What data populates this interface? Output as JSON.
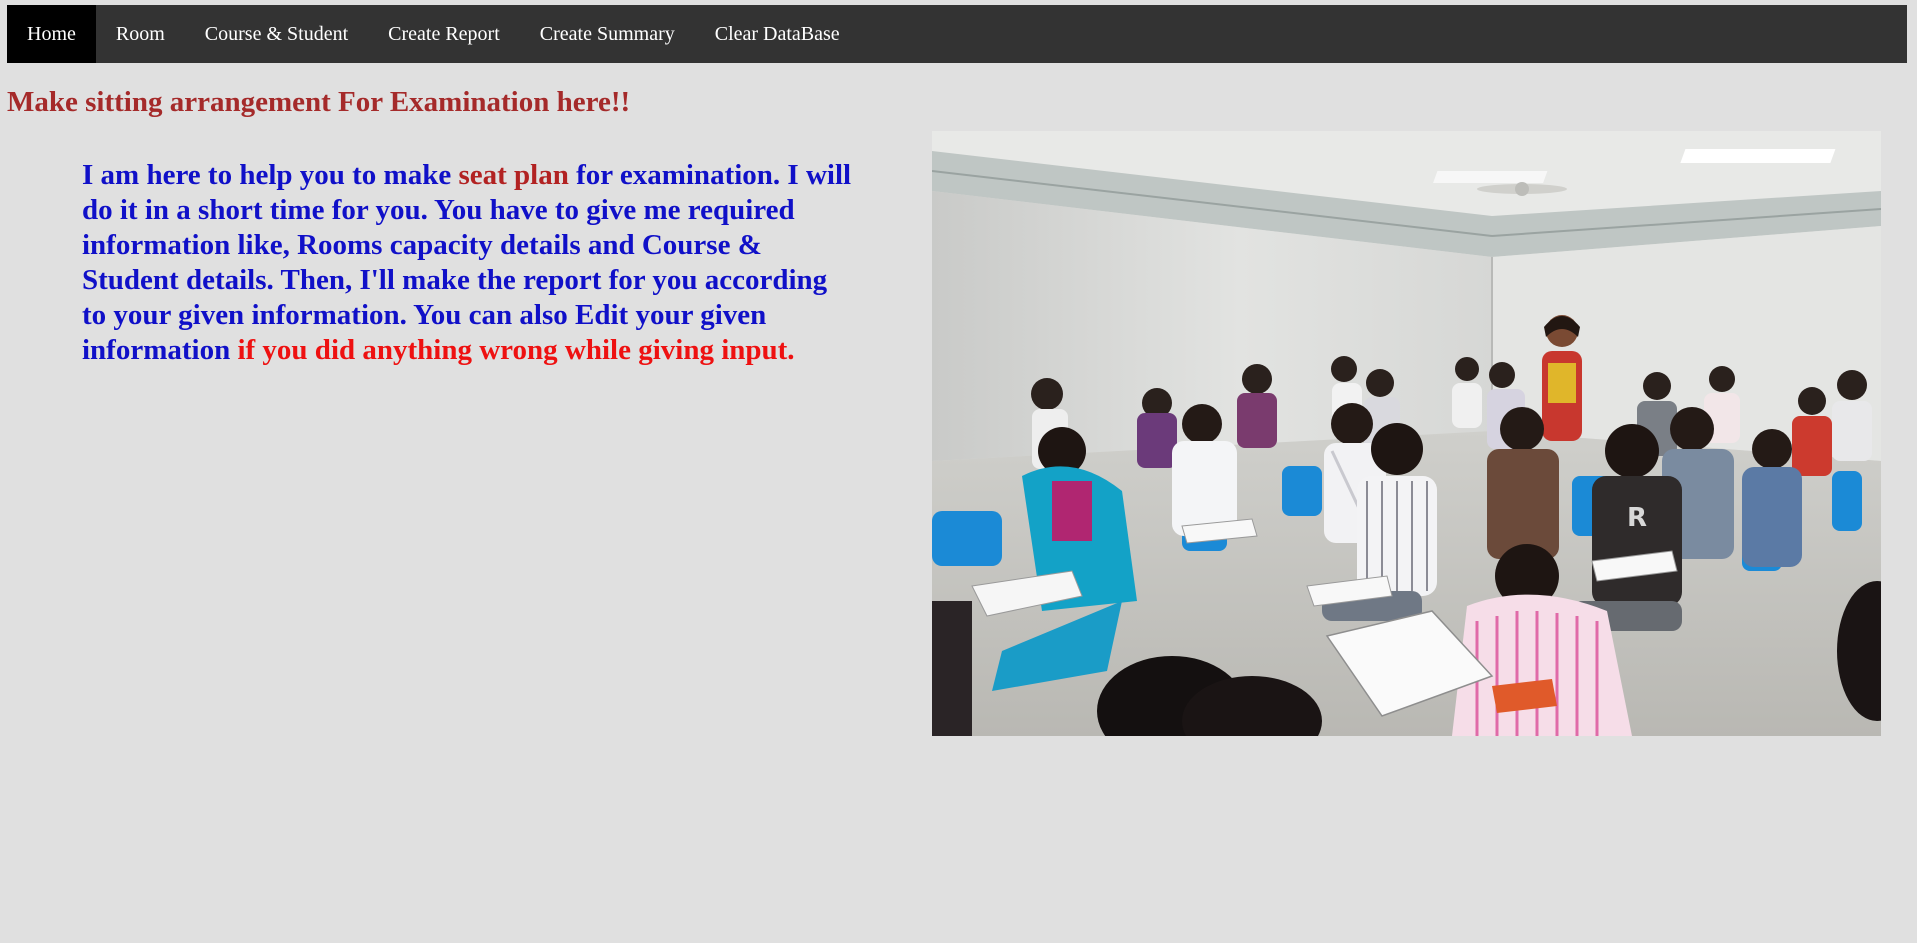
{
  "nav": {
    "items": [
      {
        "label": "Home",
        "active": true
      },
      {
        "label": "Room",
        "active": false
      },
      {
        "label": "Course & Student",
        "active": false
      },
      {
        "label": "Create Report",
        "active": false
      },
      {
        "label": "Create Summary",
        "active": false
      },
      {
        "label": "Clear DataBase",
        "active": false
      }
    ]
  },
  "main": {
    "title": "Make sitting arrangement For Examination here!!",
    "intro": {
      "part1": "I am here to help you to make ",
      "highlight_seat_plan": "seat plan",
      "part2": " for examination. I will do it in a short time for you. You have to give me required information like, Rooms capacity details and Course & Student details. Then, I'll make the report for you according to your given information. You can also Edit your given information ",
      "highlight_warning": "if you did anything wrong while giving input."
    },
    "image": {
      "subject": "students-writing-exam-in-classroom"
    }
  },
  "colors": {
    "nav_bg": "#333333",
    "nav_active_bg": "#000000",
    "page_bg": "#e0e0e0",
    "title": "#a52a2a",
    "intro_text": "#1010c8",
    "seat_plan_highlight": "#b22222",
    "warning_highlight": "#ee1111"
  }
}
